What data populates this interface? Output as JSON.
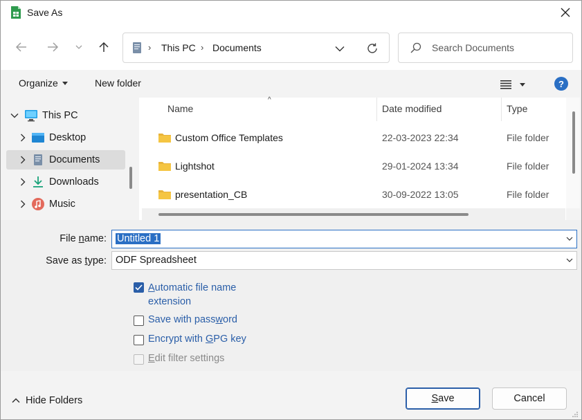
{
  "window": {
    "title": "Save As"
  },
  "nav": {
    "breadcrumb": [
      "This PC",
      "Documents"
    ],
    "search_placeholder": "Search Documents"
  },
  "toolbar": {
    "organize_label": "Organize",
    "new_folder_label": "New folder",
    "help_label": "?"
  },
  "tree": {
    "items": [
      {
        "label": "This PC",
        "icon": "pc-icon",
        "expanded": true
      },
      {
        "label": "Desktop",
        "icon": "desktop-icon"
      },
      {
        "label": "Documents",
        "icon": "documents-icon",
        "selected": true
      },
      {
        "label": "Downloads",
        "icon": "downloads-icon"
      },
      {
        "label": "Music",
        "icon": "music-icon"
      }
    ]
  },
  "filelist": {
    "columns": [
      "Name",
      "Date modified",
      "Type"
    ],
    "rows": [
      {
        "name": "Custom Office Templates",
        "date": "22-03-2023 22:34",
        "type": "File folder"
      },
      {
        "name": "Lightshot",
        "date": "29-01-2024 13:34",
        "type": "File folder"
      },
      {
        "name": "presentation_CB",
        "date": "30-09-2022 13:05",
        "type": "File folder"
      }
    ]
  },
  "form": {
    "file_name_label_pre": "File ",
    "file_name_label_u": "n",
    "file_name_label_post": "ame:",
    "file_name_value": "Untitled 1",
    "save_type_label_pre": "Save as ",
    "save_type_label_u": "t",
    "save_type_label_post": "ype:",
    "save_type_value": "ODF Spreadsheet",
    "options": {
      "auto_ext_u": "A",
      "auto_ext_line1": "utomatic file name",
      "auto_ext_line2": "extension",
      "password_pre": "Save with pass",
      "password_u": "w",
      "password_post": "ord",
      "gpg_pre": "Encrypt with ",
      "gpg_u": "G",
      "gpg_post": "PG key",
      "filter_u": "E",
      "filter_post": "dit filter settings"
    }
  },
  "footer": {
    "hide_folders_label": "Hide Folders",
    "save_u": "S",
    "save_post": "ave",
    "cancel_label": "Cancel"
  },
  "colors": {
    "accent": "#2a6fc4",
    "link": "#2a5ea8",
    "folder": "#f5c542"
  }
}
